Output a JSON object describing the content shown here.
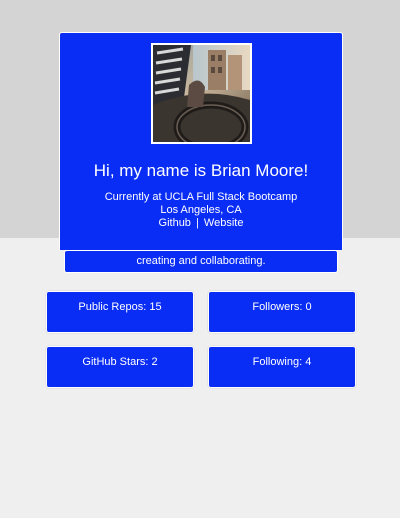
{
  "colors": {
    "card_blue": "#0a2df5",
    "top_background": "#d4d4d4",
    "page_background": "#efefef",
    "text": "#ffffff"
  },
  "profile": {
    "greeting": "Hi, my name is Brian Moore!",
    "current": "Currently at UCLA Full Stack Bootcamp",
    "location": "Los Angeles, CA",
    "github_link": "Github",
    "separator": "|",
    "website_link": "Website"
  },
  "bio": "creating and collaborating.",
  "stats": {
    "public_repos": "Public Repos: 15",
    "followers": "Followers: 0",
    "github_stars": "GitHub Stars: 2",
    "following": "Following: 4"
  }
}
